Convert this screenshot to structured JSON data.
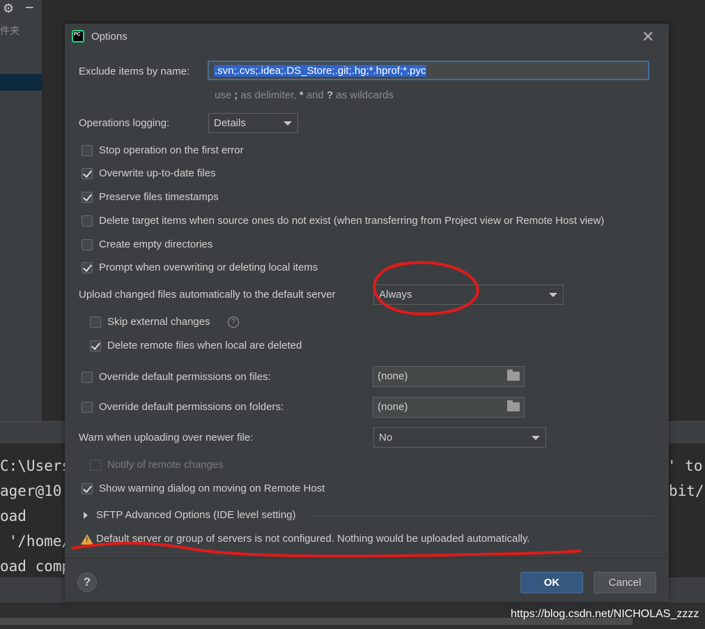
{
  "background": {
    "left_panel_text": "件夹",
    "terminal_lines": [
      {
        "left": "C:\\Users",
        "right": "' to"
      },
      {
        "left": "ager@10",
        "right": "bit/"
      },
      {
        "left": "oad",
        "right": ""
      },
      {
        "left": " '/home/",
        "right": ""
      },
      {
        "left": "oad comp",
        "right": ""
      }
    ],
    "watermark": "https://blog.csdn.net/NICHOLAS_zzzz"
  },
  "dialog": {
    "app_icon_text": "PC",
    "title": "Options",
    "exclude": {
      "label": "Exclude items by name:",
      "value": ".svn;.cvs;.idea;.DS_Store;.git;.hg;*.hprof;*.pyc",
      "hint_prefix": "use ",
      "hint_semicolon": ";",
      "hint_mid": " as delimiter, ",
      "hint_star": "*",
      "hint_and": " and ",
      "hint_q": "?",
      "hint_suffix": " as wildcards"
    },
    "operations_logging": {
      "label": "Operations logging:",
      "value": "Details"
    },
    "checkboxes": [
      {
        "label": "Stop operation on the first error",
        "checked": false
      },
      {
        "label": "Overwrite up-to-date files",
        "checked": true
      },
      {
        "label": "Preserve files timestamps",
        "checked": true
      },
      {
        "label": "Delete target items when source ones do not exist (when transferring from Project view or Remote Host view)",
        "checked": false
      },
      {
        "label": "Create empty directories",
        "checked": false
      },
      {
        "label": "Prompt when overwriting or deleting local items",
        "checked": true
      }
    ],
    "upload_auto": {
      "label": "Upload changed files automatically to the default server",
      "value": "Always"
    },
    "skip_external": {
      "label": "Skip external changes",
      "checked": false,
      "help": "?"
    },
    "delete_remote": {
      "label": "Delete remote files when local are deleted",
      "checked": true
    },
    "override_files": {
      "label": "Override default permissions on files:",
      "value": "(none)",
      "checked": false
    },
    "override_folders": {
      "label": "Override default permissions on folders:",
      "value": "(none)",
      "checked": false
    },
    "warn_newer": {
      "label": "Warn when uploading over newer file:",
      "value": "No"
    },
    "notify_remote": {
      "label": "Notify of remote changes",
      "checked": false
    },
    "show_warning": {
      "label": "Show warning dialog on moving on Remote Host",
      "checked": true
    },
    "sftp_advanced": {
      "label": "SFTP Advanced Options (IDE level setting)"
    },
    "warning_message": "Default server or group of servers is not configured. Nothing would be uploaded automatically.",
    "buttons": {
      "help": "?",
      "ok": "OK",
      "cancel": "Cancel"
    }
  },
  "colors": {
    "accent": "#365880",
    "annotation": "#e01b1b",
    "selection": "#2f65ca"
  }
}
